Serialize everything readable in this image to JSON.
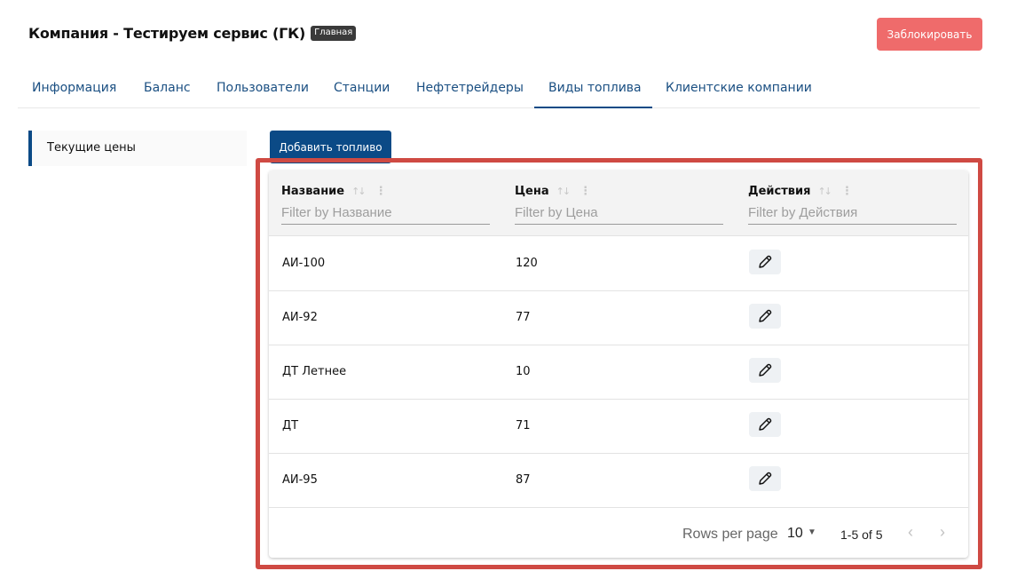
{
  "header": {
    "title": "Компания - Тестируем сервис (ГК)",
    "badge": "Главная",
    "block_button": "Заблокировать"
  },
  "tabs": [
    {
      "label": "Информация"
    },
    {
      "label": "Баланс"
    },
    {
      "label": "Пользователи"
    },
    {
      "label": "Станции"
    },
    {
      "label": "Нефтетрейдеры"
    },
    {
      "label": "Виды топлива",
      "active": true
    },
    {
      "label": "Клиентские компании"
    }
  ],
  "sidebar": {
    "items": [
      {
        "label": "Текущие цены"
      }
    ]
  },
  "toolbar": {
    "add_button": "Добавить топливо"
  },
  "table": {
    "columns": [
      {
        "header": "Название",
        "filter_placeholder": "Filter by Название"
      },
      {
        "header": "Цена",
        "filter_placeholder": "Filter by Цена"
      },
      {
        "header": "Действия",
        "filter_placeholder": "Filter by Действия"
      }
    ],
    "rows": [
      {
        "name": "АИ-100",
        "price": "120"
      },
      {
        "name": "АИ-92",
        "price": "77"
      },
      {
        "name": "ДТ Летнее",
        "price": "10"
      },
      {
        "name": "ДТ",
        "price": "71"
      },
      {
        "name": "АИ-95",
        "price": "87"
      }
    ],
    "row_action_icon": "pencil-icon",
    "pagination": {
      "rows_per_page_label": "Rows per page",
      "rows_per_page": "10",
      "range": "1-5 of 5"
    }
  },
  "colors": {
    "primary": "#0b4a86",
    "danger": "#ef6b6b",
    "highlight": "#cf4a43",
    "tab_text": "#1a4f82"
  }
}
